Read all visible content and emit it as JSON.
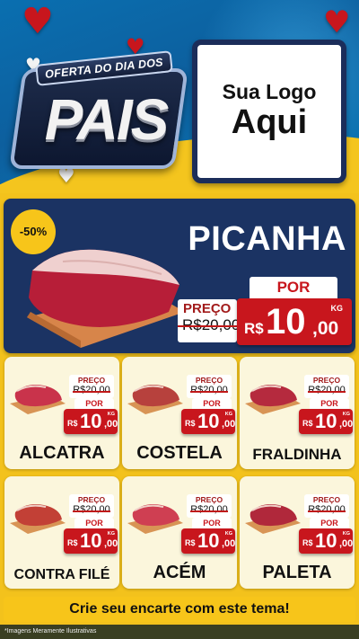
{
  "header": {
    "ribbon_text": "OFERTA DO DIA DOS",
    "big_text": "PAIS",
    "logo_line1": "Sua Logo",
    "logo_line2": "Aqui"
  },
  "colors": {
    "brand_blue": "#1b3363",
    "accent_yellow": "#f7c51a",
    "price_red": "#c8161d"
  },
  "featured": {
    "discount": "-50%",
    "name": "PICANHA",
    "old_label": "PREÇO",
    "old_price": "R$20,00",
    "por_label": "POR",
    "currency": "R$",
    "price_int": "10",
    "price_dec": ",00",
    "unit": "KG"
  },
  "products": [
    {
      "name": "ALCATRA",
      "old_label": "PREÇO",
      "old_price": "R$20,00",
      "por_label": "POR",
      "currency": "R$",
      "price_int": "10",
      "price_dec": ",00",
      "unit": "KG"
    },
    {
      "name": "COSTELA",
      "old_label": "PREÇO",
      "old_price": "R$20,00",
      "por_label": "POR",
      "currency": "R$",
      "price_int": "10",
      "price_dec": ",00",
      "unit": "KG"
    },
    {
      "name": "FRALDINHA",
      "old_label": "PREÇO",
      "old_price": "R$20,00",
      "por_label": "POR",
      "currency": "R$",
      "price_int": "10",
      "price_dec": ",00",
      "unit": "KG"
    },
    {
      "name": "CONTRA FILÉ",
      "old_label": "PREÇO",
      "old_price": "R$20,00",
      "por_label": "POR",
      "currency": "R$",
      "price_int": "10",
      "price_dec": ",00",
      "unit": "KG"
    },
    {
      "name": "ACÉM",
      "old_label": "PREÇO",
      "old_price": "R$20,00",
      "por_label": "POR",
      "currency": "R$",
      "price_int": "10",
      "price_dec": ",00",
      "unit": "KG"
    },
    {
      "name": "PALETA",
      "old_label": "PREÇO",
      "old_price": "R$20,00",
      "por_label": "POR",
      "currency": "R$",
      "price_int": "10",
      "price_dec": ",00",
      "unit": "KG"
    }
  ],
  "cta": "Crie seu encarte com este tema!",
  "footer_note": "*Imagens Meramente Ilustrativas"
}
